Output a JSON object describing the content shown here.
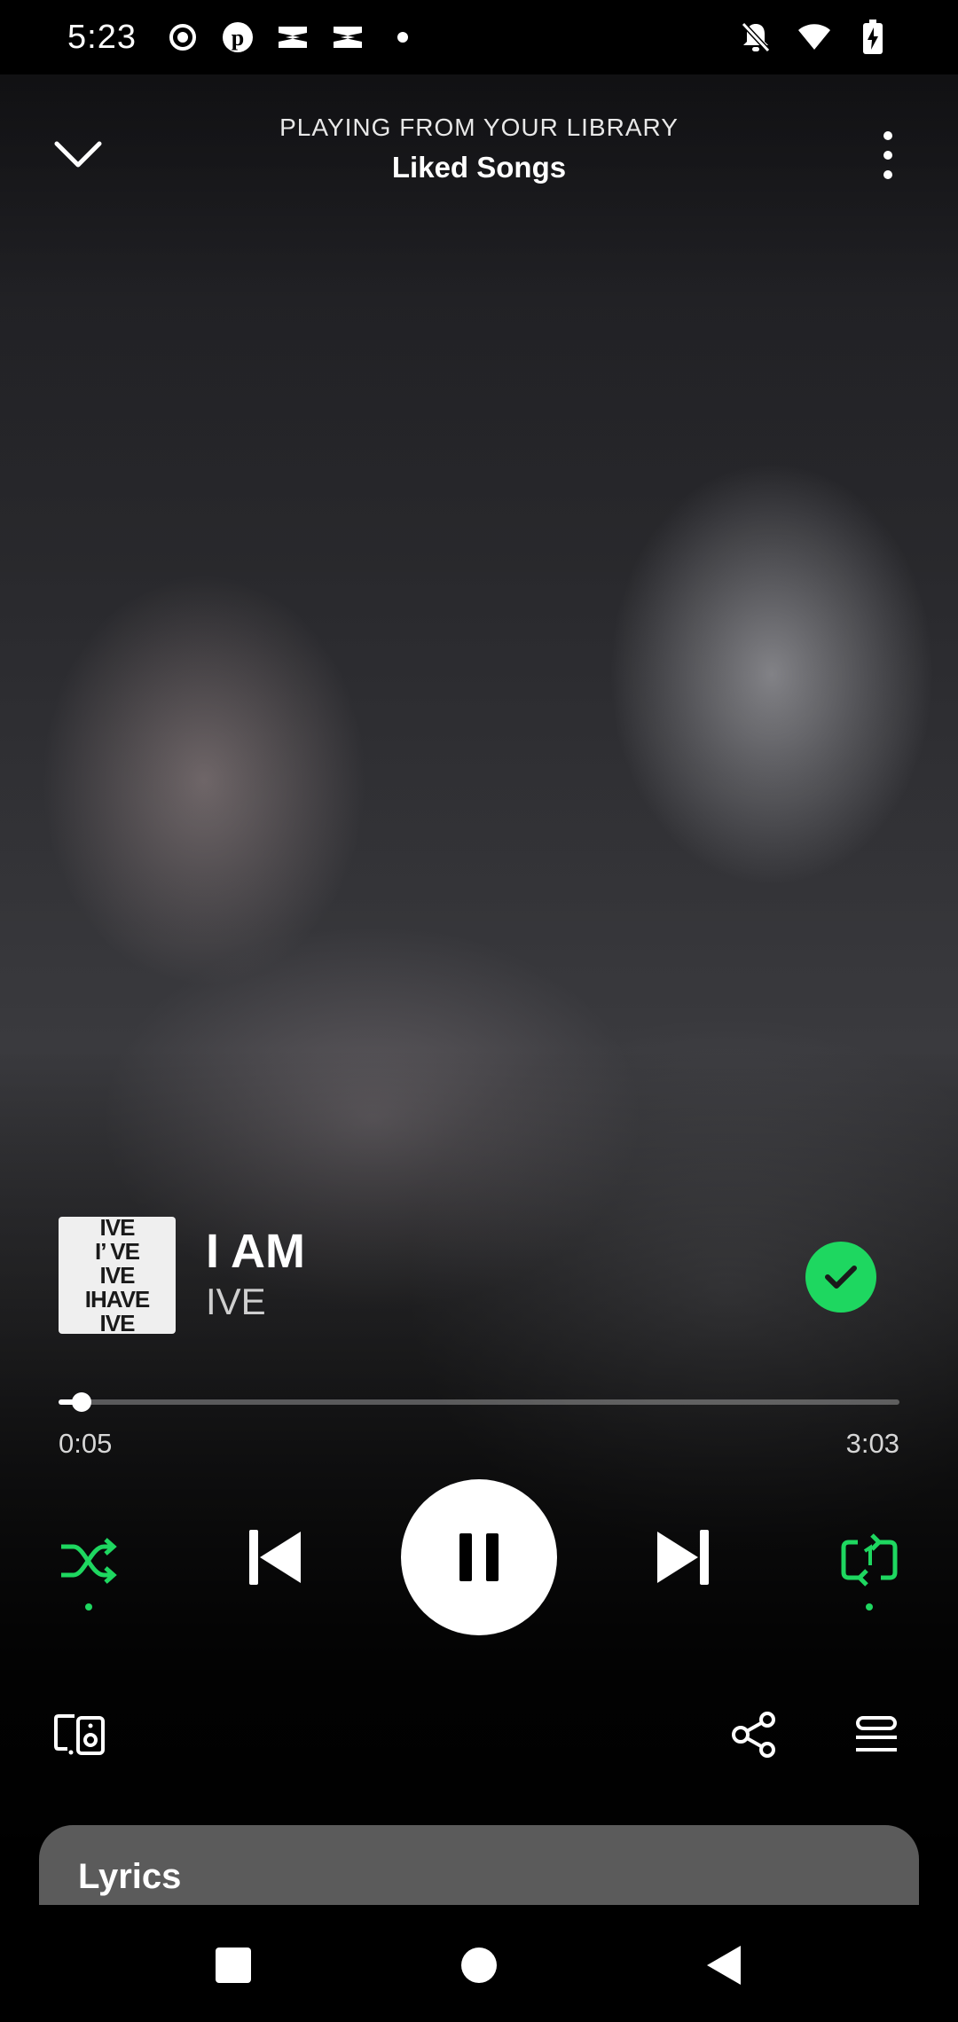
{
  "status_bar": {
    "time": "5:23",
    "left_icons": [
      "record-icon",
      "pinterest-icon",
      "capcut-icon",
      "capcut-icon",
      "dot-icon"
    ],
    "right_icons": [
      "notifications-off-icon",
      "wifi-icon",
      "battery-charging-icon"
    ]
  },
  "header": {
    "context_label": "PLAYING FROM YOUR LIBRARY",
    "context_name": "Liked Songs"
  },
  "track": {
    "title": "I AM",
    "artist": "IVE",
    "cover_lines": [
      "IVE",
      "I’ VE",
      "IVE",
      "IHAVE",
      "IVE"
    ],
    "liked": true
  },
  "progress": {
    "elapsed": "0:05",
    "total": "3:03",
    "fraction": 0.027
  },
  "controls": {
    "shuffle_active": true,
    "repeat_mode": "one",
    "state": "playing"
  },
  "lyrics": {
    "title": "Lyrics"
  },
  "colors": {
    "accent": "#1ed760",
    "card": "#5b5b5b",
    "background": "#000000"
  }
}
